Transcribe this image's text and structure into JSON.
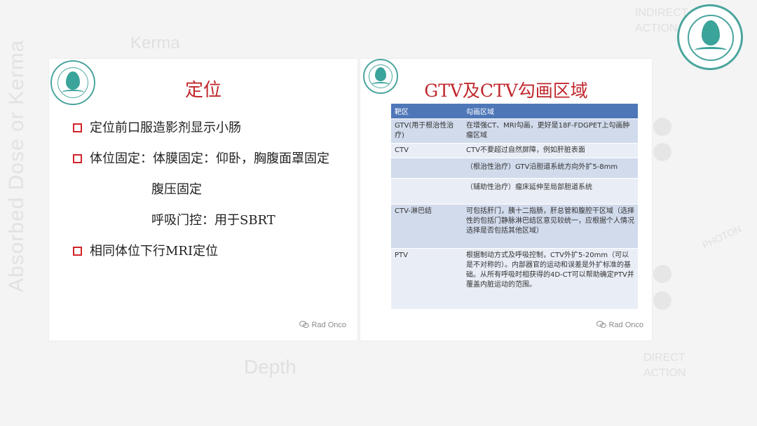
{
  "background": {
    "y_axis_label": "Absorbed Dose or Kerma",
    "kerma_label": "Kerma",
    "depth_label": "Depth",
    "indirect_action": "INDIRECT ACTION",
    "direct_action": "DIRECT ACTION",
    "photon_label": "PHOTON"
  },
  "left_slide": {
    "title": "定位",
    "bullets": [
      "定位前口服造影剂显示小肠",
      "体位固定：体膜固定：仰卧，胸腹面罩固定"
    ],
    "sub_lines": [
      "腹压固定",
      "呼吸门控：用于SBRT"
    ],
    "last_bullet": "相同体位下行MRI定位",
    "watermark": "Rad Onco"
  },
  "right_slide": {
    "title": "GTV及CTV勾画区域",
    "table": {
      "headers": [
        "靶区",
        "勾画区域"
      ],
      "rows": [
        {
          "target": "GTV(用于根治性治疗)",
          "area": "在增强CT、MRI勾画，更好是18F-FDGPET上勾画肿瘤区域"
        },
        {
          "target": "CTV",
          "area": "CTV不要超过自然屏障，例如肝脏表面"
        },
        {
          "target": "",
          "area": "（根治性治疗）GTV沿胆道系统方向外扩5-8mm"
        },
        {
          "target": "",
          "area": "（辅助性治疗）瘤床延伸至局部胆道系统"
        },
        {
          "target": "CTV-淋巴结",
          "area": "可包括肝门，胰十二指肠，肝总管和腹腔干区域（选择性的包括门静脉淋巴结区意见较统一，应根据个人情况选择是否包括其他区域）"
        },
        {
          "target": "PTV",
          "area": "根据制动方式及呼吸控制，CTV外扩5-20mm（可以是不对称的）。内部器官的运动和误差是外扩标准的基础。从所有呼吸时相获得的4D-CT可以帮助确定PTV并覆盖内脏运动的范围。"
        }
      ]
    },
    "watermark": "Rad Onco"
  },
  "colors": {
    "title_red": "#c0282d",
    "bullet_red": "#d3232a",
    "table_header": "#4e77b8",
    "logo_teal": "#3aa39a"
  }
}
